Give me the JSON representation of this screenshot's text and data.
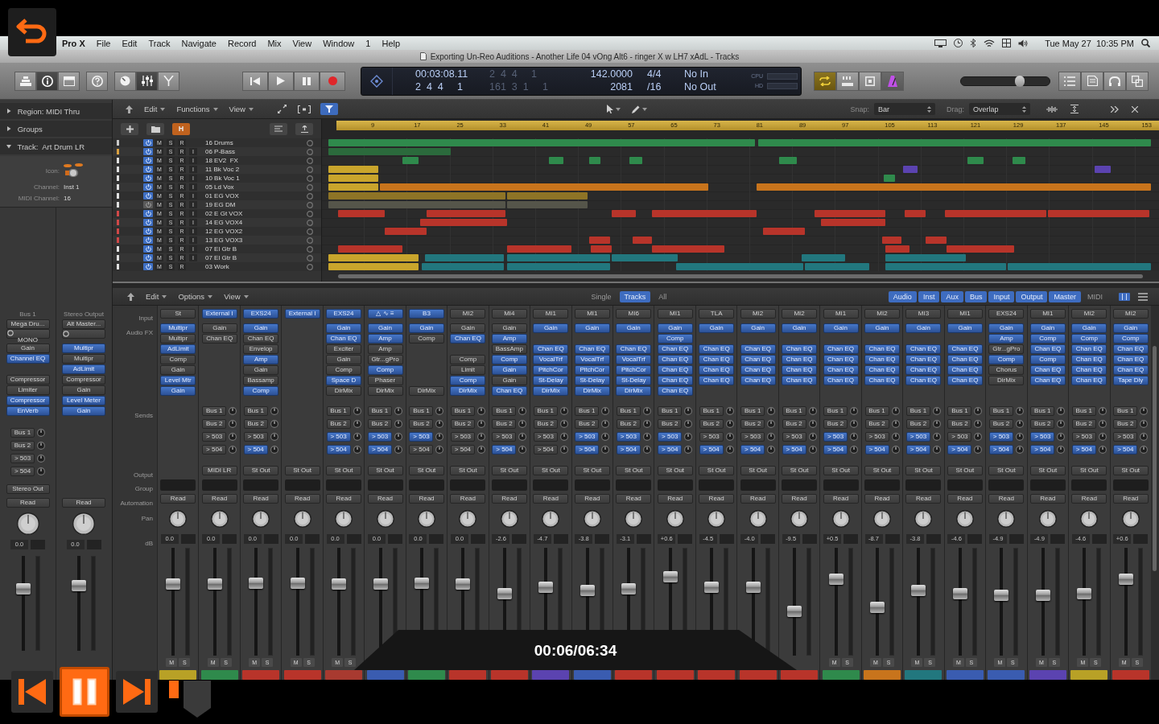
{
  "player": {
    "time": "00:06/06:34"
  },
  "menu_bar": {
    "items": [
      "Pro X",
      "File",
      "Edit",
      "Track",
      "Navigate",
      "Record",
      "Mix",
      "View",
      "Window",
      "1",
      "Help"
    ],
    "clock": "Tue May 27  10:35 PM"
  },
  "window": {
    "title": "Exporting Un-Reo Auditions - Another Life 04 vOng Alt6 - ringer X w LH7 xAdL - Tracks"
  },
  "toolbar": {
    "view_buttons": [
      {
        "selected": false
      },
      {
        "selected": true
      },
      {
        "selected": false
      },
      {
        "selected": false
      },
      {
        "selected": false
      },
      {
        "selected": true
      },
      {
        "selected": false
      }
    ],
    "lcd": {
      "time": "00:03:08.11",
      "bars": "2  4  4     1",
      "time_dim": "2  4  4     1",
      "bars_dim": "161  3  1     1",
      "tempo": "142.0000",
      "tempo_sub": "2081",
      "signature": "4/4",
      "division": "/16",
      "in": "No In",
      "out": "No Out",
      "cpu": "CPU",
      "hd": "HD"
    },
    "mode_buttons": [
      {
        "selected": true
      },
      {
        "selected": false
      },
      {
        "selected": false
      },
      {
        "selected": true
      }
    ],
    "volume": {
      "level": 0.68
    }
  },
  "inspector": {
    "sections": [
      {
        "label": "Region: MIDI Thru",
        "expanded": false
      },
      {
        "label": "Groups",
        "expanded": false
      },
      {
        "label": "Track:  Art Drum LR",
        "expanded": true
      }
    ],
    "params": [
      {
        "kind": "icon",
        "label": "Icon:"
      },
      {
        "kind": "text",
        "label": "Channel:",
        "value": "Inst 1"
      },
      {
        "kind": "text",
        "label": "MIDI Channel:",
        "value": "16"
      }
    ],
    "strips": [
      {
        "header": "Bus 1",
        "input": "Mega Dru...",
        "format": "MONO",
        "fx": [
          {
            "kind": "plugin",
            "name": "Gain",
            "on": false
          },
          {
            "kind": "plugin",
            "name": "Channel EQ",
            "on": true
          },
          {
            "kind": "empty"
          },
          {
            "kind": "plugin",
            "name": "Compressor",
            "on": false
          },
          {
            "kind": "plugin",
            "name": "Limiter",
            "on": false
          },
          {
            "kind": "plugin",
            "name": "Compressor",
            "on": true
          },
          {
            "kind": "plugin",
            "name": "EnVerb",
            "on": true
          }
        ],
        "sends": [
          {
            "name": "Bus 1",
            "on": false
          },
          {
            "name": "Bus 2",
            "on": false
          },
          {
            "name": "> 503",
            "on": false
          },
          {
            "name": "> 504",
            "on": false
          }
        ],
        "output": "Stereo Out",
        "automation": "Read",
        "db": "0.0",
        "level": 0.67
      },
      {
        "header": "Stereo Output",
        "input": "Alt Master...",
        "fx": [
          {
            "kind": "plugin",
            "name": "Multipr",
            "on": true
          },
          {
            "kind": "plugin",
            "name": "Multipr",
            "on": false
          },
          {
            "kind": "plugin",
            "name": "AdLimit",
            "on": true
          },
          {
            "kind": "plugin",
            "name": "Compressor",
            "on": false
          },
          {
            "kind": "plugin",
            "name": "Gain",
            "on": false
          },
          {
            "kind": "plugin",
            "name": "Level Meter",
            "on": true
          },
          {
            "kind": "plugin",
            "name": "Gain",
            "on": true
          }
        ],
        "automation": "Read",
        "db": "0.0",
        "level": 0.71
      }
    ]
  },
  "tracks": {
    "menus": [
      "Edit",
      "Functions",
      "View"
    ],
    "snap_label": "Snap:",
    "snap": "Bar",
    "drag_label": "Drag:",
    "drag": "Overlap",
    "hide_button": {
      "label": "H",
      "on": true
    },
    "ruler": [
      "9",
      "17",
      "25",
      "33",
      "41",
      "49",
      "57",
      "65",
      "73",
      "81",
      "89",
      "97",
      "105",
      "113",
      "121",
      "129",
      "137",
      "145",
      "153"
    ],
    "rows": [
      {
        "name": "16 Drums",
        "color": "#c9c9c9",
        "enabled": true,
        "buttons": [
          "M",
          "S",
          "R"
        ]
      },
      {
        "name": "06 P-Bass",
        "color": "#d9a040",
        "enabled": true,
        "buttons": [
          "M",
          "S",
          "R",
          "I"
        ]
      },
      {
        "name": "18 EV2  FX",
        "color": "#e0e0e0",
        "enabled": true,
        "buttons": [
          "M",
          "S",
          "R",
          "I"
        ]
      },
      {
        "name": "11 Bk Voc 2",
        "color": "#e0e0e0",
        "enabled": true,
        "buttons": [
          "M",
          "S",
          "R",
          "I"
        ]
      },
      {
        "name": "10 Bk Voc 1",
        "color": "#e0e0e0",
        "enabled": true,
        "buttons": [
          "M",
          "S",
          "R",
          "I"
        ]
      },
      {
        "name": "05 Ld Vox",
        "color": "#e0e0e0",
        "enabled": true,
        "buttons": [
          "M",
          "S",
          "R",
          "I"
        ]
      },
      {
        "name": "01 EG VOX",
        "color": "#e0e0e0",
        "enabled": true,
        "buttons": [
          "M",
          "S",
          "R",
          "I"
        ]
      },
      {
        "name": "19 EG DM",
        "color": "#e0e0e0",
        "enabled": false,
        "buttons": [
          "M",
          "S",
          "R",
          "I"
        ]
      },
      {
        "name": "02 E Gt VOX",
        "color": "#d04848",
        "enabled": true,
        "buttons": [
          "M",
          "S",
          "R",
          "I"
        ]
      },
      {
        "name": "14 EG VOX4",
        "color": "#d04848",
        "enabled": true,
        "buttons": [
          "M",
          "S",
          "R",
          "I"
        ]
      },
      {
        "name": "12 EG VOX2",
        "color": "#d04848",
        "enabled": true,
        "buttons": [
          "M",
          "S",
          "R",
          "I"
        ]
      },
      {
        "name": "13 EG VOX3",
        "color": "#d04848",
        "enabled": true,
        "buttons": [
          "M",
          "S",
          "R",
          "I"
        ]
      },
      {
        "name": "07 El Gtr B",
        "color": "#e0e0e0",
        "enabled": true,
        "buttons": [
          "M",
          "S",
          "R",
          "I"
        ]
      },
      {
        "name": "07 El Gtr B",
        "color": "#e0e0e0",
        "enabled": true,
        "buttons": [
          "M",
          "S",
          "R",
          "I"
        ]
      },
      {
        "name": "03 Work",
        "color": "#e0e0e0",
        "enabled": true,
        "buttons": [
          "M",
          "S",
          "R"
        ]
      }
    ]
  },
  "mixer": {
    "menus": [
      "Edit",
      "Options",
      "View"
    ],
    "views": [
      {
        "label": "Single",
        "selected": false
      },
      {
        "label": "Tracks",
        "selected": true
      },
      {
        "label": "All",
        "selected": false
      }
    ],
    "filters": [
      {
        "label": "Audio",
        "selected": true
      },
      {
        "label": "Inst",
        "selected": true
      },
      {
        "label": "Aux",
        "selected": true
      },
      {
        "label": "Bus",
        "selected": true
      },
      {
        "label": "Input",
        "selected": true
      },
      {
        "label": "Output",
        "selected": true
      },
      {
        "label": "Master",
        "selected": true
      },
      {
        "label": "MIDI",
        "selected": false
      }
    ],
    "row_labels": [
      "Input",
      "Audio FX",
      "Sends",
      "Output",
      "Group",
      "Automation",
      "Pan",
      "dB"
    ],
    "strips": [
      {
        "input": "St",
        "input_on": false,
        "fx": [
          {
            "kind": "plugin",
            "name": "Multipr",
            "on": true
          },
          {
            "kind": "plugin",
            "name": "Multipr",
            "on": false
          },
          {
            "kind": "plugin",
            "name": "AdLimit",
            "on": true
          },
          {
            "kind": "plugin",
            "name": "Comp",
            "on": false
          },
          {
            "kind": "plugin",
            "name": "Gain",
            "on": false
          },
          {
            "kind": "plugin",
            "name": "Level Mtr",
            "on": true
          },
          {
            "kind": "plugin",
            "name": "Gain",
            "on": true
          }
        ],
        "automation": "Read",
        "db": "0.0",
        "level": 0.68,
        "buttons": [
          "M",
          "S"
        ],
        "color": "#b8a126"
      },
      {
        "input": "External I",
        "input_on": true,
        "fx": [
          {
            "kind": "plugin",
            "name": "Gain",
            "on": false
          },
          {
            "kind": "plugin",
            "name": "Chan EQ",
            "on": false
          }
        ],
        "sends": [
          {
            "name": "Bus 1",
            "on": false
          },
          {
            "name": "Bus 2",
            "on": false
          },
          {
            "name": "> 503",
            "on": false
          },
          {
            "name": "> 504",
            "on": false
          }
        ],
        "output": "MIDI LR",
        "automation": "Read",
        "db": "0.0",
        "level": 0.68,
        "buttons": [
          "M",
          "S"
        ],
        "color": "#2f8a4c"
      },
      {
        "input": "EXS24",
        "input_on": true,
        "fx": [
          {
            "kind": "plugin",
            "name": "Gain",
            "on": true
          },
          {
            "kind": "plugin",
            "name": "Chan EQ",
            "on": false
          },
          {
            "kind": "plugin",
            "name": "Envelop",
            "on": false
          },
          {
            "kind": "plugin",
            "name": "Amp",
            "on": true
          },
          {
            "kind": "plugin",
            "name": "Gain",
            "on": false
          },
          {
            "kind": "plugin",
            "name": "Bassamp",
            "on": false
          },
          {
            "kind": "plugin",
            "name": "Comp",
            "on": true
          }
        ],
        "sends": [
          {
            "name": "Bus 1",
            "on": false
          },
          {
            "name": "Bus 2",
            "on": false
          },
          {
            "name": "> 503",
            "on": false
          },
          {
            "name": "> 504",
            "on": true
          }
        ],
        "output": "St Out",
        "automation": "Read",
        "db": "0.0",
        "level": 0.69,
        "buttons": [
          "M",
          "S"
        ],
        "color": "#b8342a"
      },
      {
        "input": "External I",
        "input_on": true,
        "output": "St Out",
        "automation": "Read",
        "db": "0.0",
        "level": 0.69,
        "buttons": [
          "M",
          "S"
        ],
        "color": "#b8342a"
      },
      {
        "input": "EXS24",
        "input_on": true,
        "fx": [
          {
            "kind": "plugin",
            "name": "Gain",
            "on": true
          },
          {
            "kind": "plugin",
            "name": "Chan EQ",
            "on": true
          },
          {
            "kind": "plugin",
            "name": "Exciter",
            "on": false
          },
          {
            "kind": "plugin",
            "name": "Gain",
            "on": false
          },
          {
            "kind": "plugin",
            "name": "Comp",
            "on": false
          },
          {
            "kind": "plugin",
            "name": "Space D",
            "on": true
          },
          {
            "kind": "plugin",
            "name": "DirMix",
            "on": false
          }
        ],
        "sends": [
          {
            "name": "Bus 1",
            "on": false
          },
          {
            "name": "Bus 2",
            "on": false
          },
          {
            "name": "> 503",
            "on": true
          },
          {
            "name": "> 504",
            "on": true
          }
        ],
        "output": "St Out",
        "automation": "Read",
        "db": "0.0",
        "level": 0.68,
        "buttons": [
          "M",
          "S"
        ],
        "color": "#a83a30"
      },
      {
        "input": "△ ∿ ≡",
        "input_on": true,
        "fx": [
          {
            "kind": "plugin",
            "name": "Gain",
            "on": true
          },
          {
            "kind": "plugin",
            "name": "Amp",
            "on": true
          },
          {
            "kind": "plugin",
            "name": "Amp",
            "on": false
          },
          {
            "kind": "plugin",
            "name": "Gtr...gPro",
            "on": false
          },
          {
            "kind": "plugin",
            "name": "Comp",
            "on": true
          },
          {
            "kind": "plugin",
            "name": "Phaser",
            "on": false
          },
          {
            "kind": "plugin",
            "name": "DirMix",
            "on": false
          }
        ],
        "sends": [
          {
            "name": "Bus 1",
            "on": false
          },
          {
            "name": "Bus 2",
            "on": false
          },
          {
            "name": "> 503",
            "on": true
          },
          {
            "name": "> 504",
            "on": true
          }
        ],
        "output": "St Out",
        "automation": "Read",
        "db": "0.0",
        "level": 0.68,
        "color": "#3a5cb0"
      },
      {
        "input": "B3",
        "input_on": true,
        "fx": [
          {
            "kind": "plugin",
            "name": "Gain",
            "on": true
          },
          {
            "kind": "plugin",
            "name": "Comp",
            "on": false
          },
          {
            "kind": "empty"
          },
          {
            "kind": "empty"
          },
          {
            "kind": "empty"
          },
          {
            "kind": "empty"
          },
          {
            "kind": "plugin",
            "name": "DirMix",
            "on": false
          }
        ],
        "sends": [
          {
            "name": "Bus 1",
            "on": false
          },
          {
            "name": "Bus 2",
            "on": false
          },
          {
            "name": "> 503",
            "on": true
          },
          {
            "name": "> 504",
            "on": false
          }
        ],
        "output": "St Out",
        "automation": "Read",
        "db": "0.0",
        "level": 0.69,
        "color": "#2f8a4c"
      },
      {
        "input": "MI2",
        "input_on": false,
        "fx": [
          {
            "kind": "plugin",
            "name": "Gain",
            "on": false
          },
          {
            "kind": "plugin",
            "name": "Chan EQ",
            "on": true
          },
          {
            "kind": "empty"
          },
          {
            "kind": "plugin",
            "name": "Comp",
            "on": false
          },
          {
            "kind": "plugin",
            "name": "Limit",
            "on": false
          },
          {
            "kind": "plugin",
            "name": "Comp",
            "on": true
          },
          {
            "kind": "plugin",
            "name": "DirMix",
            "on": true
          }
        ],
        "sends": [
          {
            "name": "Bus 1",
            "on": false
          },
          {
            "name": "Bus 2",
            "on": false
          },
          {
            "name": "> 503",
            "on": false
          },
          {
            "name": "> 504",
            "on": false
          }
        ],
        "output": "St Out",
        "automation": "Read",
        "db": "0.0",
        "level": 0.68,
        "color": "#b8342a"
      },
      {
        "input": "MI4",
        "input_on": false,
        "fx": [
          {
            "kind": "plugin",
            "name": "Gain",
            "on": false
          },
          {
            "kind": "plugin",
            "name": "Amp",
            "on": true
          },
          {
            "kind": "plugin",
            "name": "BassAmp",
            "on": false
          },
          {
            "kind": "plugin",
            "name": "Comp",
            "on": true
          },
          {
            "kind": "plugin",
            "name": "Gain",
            "on": true
          },
          {
            "kind": "plugin",
            "name": "Gain",
            "on": false
          },
          {
            "kind": "plugin",
            "name": "Chan EQ",
            "on": true
          }
        ],
        "sends": [
          {
            "name": "Bus 1",
            "on": false
          },
          {
            "name": "Bus 2",
            "on": false
          },
          {
            "name": "> 503",
            "on": false
          },
          {
            "name": "> 504",
            "on": true
          }
        ],
        "output": "St Out",
        "automation": "Read",
        "db": "-2.6",
        "level": 0.58,
        "color": "#b8342a"
      },
      {
        "input": "MI1",
        "input_on": false,
        "fx": [
          {
            "kind": "plugin",
            "name": "Gain",
            "on": true
          },
          {
            "kind": "empty"
          },
          {
            "kind": "plugin",
            "name": "Chan EQ",
            "on": true
          },
          {
            "kind": "plugin",
            "name": "VocalTrf",
            "on": true
          },
          {
            "kind": "plugin",
            "name": "PitchCor",
            "on": true
          },
          {
            "kind": "plugin",
            "name": "St-Delay",
            "on": true
          },
          {
            "kind": "plugin",
            "name": "DirMix",
            "on": true
          }
        ],
        "sends": [
          {
            "name": "Bus 1",
            "on": false
          },
          {
            "name": "Bus 2",
            "on": false
          },
          {
            "name": "> 503",
            "on": false
          },
          {
            "name": "> 504",
            "on": false
          }
        ],
        "output": "St Out",
        "automation": "Read",
        "db": "-4.7",
        "level": 0.65,
        "color": "#5b43b0"
      },
      {
        "input": "MI1",
        "input_on": false,
        "fx": [
          {
            "kind": "plugin",
            "name": "Gain",
            "on": true
          },
          {
            "kind": "empty"
          },
          {
            "kind": "plugin",
            "name": "Chan EQ",
            "on": true
          },
          {
            "kind": "plugin",
            "name": "VocalTrf",
            "on": true
          },
          {
            "kind": "plugin",
            "name": "PitchCor",
            "on": true
          },
          {
            "kind": "plugin",
            "name": "St-Delay",
            "on": true
          },
          {
            "kind": "plugin",
            "name": "DirMix",
            "on": true
          }
        ],
        "sends": [
          {
            "name": "Bus 1",
            "on": false
          },
          {
            "name": "Bus 2",
            "on": false
          },
          {
            "name": "> 503",
            "on": true
          },
          {
            "name": "> 504",
            "on": true
          }
        ],
        "output": "St Out",
        "automation": "Read",
        "db": "-3.8",
        "level": 0.62,
        "color": "#3a5cb0"
      },
      {
        "input": "MI6",
        "input_on": false,
        "fx": [
          {
            "kind": "plugin",
            "name": "Gain",
            "on": true
          },
          {
            "kind": "empty"
          },
          {
            "kind": "plugin",
            "name": "Chan EQ",
            "on": true
          },
          {
            "kind": "plugin",
            "name": "VocalTrf",
            "on": true
          },
          {
            "kind": "plugin",
            "name": "PitchCor",
            "on": true
          },
          {
            "kind": "plugin",
            "name": "St-Delay",
            "on": true
          },
          {
            "kind": "plugin",
            "name": "DirMix",
            "on": true
          }
        ],
        "sends": [
          {
            "name": "Bus 1",
            "on": false
          },
          {
            "name": "Bus 2",
            "on": false
          },
          {
            "name": "> 503",
            "on": true
          },
          {
            "name": "> 504",
            "on": true
          }
        ],
        "output": "St Out",
        "automation": "Read",
        "db": "-3.1",
        "level": 0.63,
        "color": "#b8342a"
      },
      {
        "input": "MI1",
        "input_on": false,
        "fx": [
          {
            "kind": "plugin",
            "name": "Gain",
            "on": true
          },
          {
            "kind": "plugin",
            "name": "Comp",
            "on": true
          },
          {
            "kind": "plugin",
            "name": "Chan EQ",
            "on": true
          },
          {
            "kind": "plugin",
            "name": "Chan EQ",
            "on": true
          },
          {
            "kind": "plugin",
            "name": "Chan EQ",
            "on": true
          },
          {
            "kind": "plugin",
            "name": "Chan EQ",
            "on": true
          },
          {
            "kind": "plugin",
            "name": "Chan EQ",
            "on": true
          }
        ],
        "sends": [
          {
            "name": "Bus 1",
            "on": false
          },
          {
            "name": "Bus 2",
            "on": false
          },
          {
            "name": "> 503",
            "on": true
          },
          {
            "name": "> 504",
            "on": true
          }
        ],
        "output": "St Out",
        "automation": "Read",
        "db": "+0.6",
        "level": 0.76,
        "color": "#b8342a"
      },
      {
        "input": "TLA",
        "input_on": false,
        "fx": [
          {
            "kind": "plugin",
            "name": "Gain",
            "on": true
          },
          {
            "kind": "empty"
          },
          {
            "kind": "plugin",
            "name": "Chan EQ",
            "on": true
          },
          {
            "kind": "plugin",
            "name": "Chan EQ",
            "on": true
          },
          {
            "kind": "plugin",
            "name": "Chan EQ",
            "on": true
          },
          {
            "kind": "plugin",
            "name": "Chan EQ",
            "on": true
          }
        ],
        "sends": [
          {
            "name": "Bus 1",
            "on": false
          },
          {
            "name": "Bus 2",
            "on": false
          },
          {
            "name": "> 503",
            "on": false
          },
          {
            "name": "> 504",
            "on": true
          }
        ],
        "output": "St Out",
        "automation": "Read",
        "db": "-4.5",
        "level": 0.65,
        "color": "#b8342a"
      },
      {
        "input": "MI2",
        "input_on": false,
        "fx": [
          {
            "kind": "plugin",
            "name": "Gain",
            "on": true
          },
          {
            "kind": "empty"
          },
          {
            "kind": "plugin",
            "name": "Chan EQ",
            "on": true
          },
          {
            "kind": "plugin",
            "name": "Chan EQ",
            "on": true
          },
          {
            "kind": "plugin",
            "name": "Chan EQ",
            "on": true
          },
          {
            "kind": "plugin",
            "name": "Chan EQ",
            "on": true
          }
        ],
        "sends": [
          {
            "name": "Bus 1",
            "on": false
          },
          {
            "name": "Bus 2",
            "on": false
          },
          {
            "name": "> 503",
            "on": false
          },
          {
            "name": "> 504",
            "on": true
          }
        ],
        "output": "St Out",
        "automation": "Read",
        "db": "-4.0",
        "level": 0.65,
        "color": "#b8342a"
      },
      {
        "input": "MI2",
        "input_on": false,
        "fx": [
          {
            "kind": "plugin",
            "name": "Gain",
            "on": true
          },
          {
            "kind": "empty"
          },
          {
            "kind": "plugin",
            "name": "Chan EQ",
            "on": true
          },
          {
            "kind": "plugin",
            "name": "Chan EQ",
            "on": true
          },
          {
            "kind": "plugin",
            "name": "Chan EQ",
            "on": true
          },
          {
            "kind": "plugin",
            "name": "Chan EQ",
            "on": true
          }
        ],
        "sends": [
          {
            "name": "Bus 1",
            "on": false
          },
          {
            "name": "Bus 2",
            "on": false
          },
          {
            "name": "> 503",
            "on": false
          },
          {
            "name": "> 504",
            "on": true
          }
        ],
        "output": "St Out",
        "automation": "Read",
        "db": "-9.5",
        "level": 0.4,
        "color": "#b8342a"
      },
      {
        "input": "MI1",
        "input_on": false,
        "fx": [
          {
            "kind": "plugin",
            "name": "Gain",
            "on": true
          },
          {
            "kind": "empty"
          },
          {
            "kind": "plugin",
            "name": "Chan EQ",
            "on": true
          },
          {
            "kind": "plugin",
            "name": "Chan EQ",
            "on": true
          },
          {
            "kind": "plugin",
            "name": "Chan EQ",
            "on": true
          },
          {
            "kind": "plugin",
            "name": "Chan EQ",
            "on": true
          }
        ],
        "sends": [
          {
            "name": "Bus 1",
            "on": false
          },
          {
            "name": "Bus 2",
            "on": false
          },
          {
            "name": "> 503",
            "on": true
          },
          {
            "name": "> 504",
            "on": true
          }
        ],
        "output": "St Out",
        "automation": "Read",
        "db": "+0.5",
        "level": 0.73,
        "buttons": [
          "M",
          "S"
        ],
        "color": "#2f8a4c"
      },
      {
        "input": "MI2",
        "input_on": false,
        "fx": [
          {
            "kind": "plugin",
            "name": "Gain",
            "on": true
          },
          {
            "kind": "empty"
          },
          {
            "kind": "plugin",
            "name": "Chan EQ",
            "on": true
          },
          {
            "kind": "plugin",
            "name": "Chan EQ",
            "on": true
          },
          {
            "kind": "plugin",
            "name": "Chan EQ",
            "on": true
          },
          {
            "kind": "plugin",
            "name": "Chan EQ",
            "on": true
          }
        ],
        "sends": [
          {
            "name": "Bus 1",
            "on": false
          },
          {
            "name": "Bus 2",
            "on": false
          },
          {
            "name": "> 503",
            "on": false
          },
          {
            "name": "> 504",
            "on": true
          }
        ],
        "output": "St Out",
        "automation": "Read",
        "db": "-8.7",
        "level": 0.44,
        "buttons": [
          "M",
          "S"
        ],
        "color": "#c8741c"
      },
      {
        "input": "MI3",
        "input_on": false,
        "fx": [
          {
            "kind": "plugin",
            "name": "Gain",
            "on": true
          },
          {
            "kind": "empty"
          },
          {
            "kind": "plugin",
            "name": "Chan EQ",
            "on": true
          },
          {
            "kind": "plugin",
            "name": "Chan EQ",
            "on": true
          },
          {
            "kind": "plugin",
            "name": "Chan EQ",
            "on": true
          },
          {
            "kind": "plugin",
            "name": "Chan EQ",
            "on": true
          }
        ],
        "sends": [
          {
            "name": "Bus 1",
            "on": false
          },
          {
            "name": "Bus 2",
            "on": false
          },
          {
            "name": "> 503",
            "on": true
          },
          {
            "name": "> 504",
            "on": true
          }
        ],
        "output": "St Out",
        "automation": "Read",
        "db": "-3.8",
        "level": 0.62,
        "buttons": [
          "M",
          "S"
        ],
        "color": "#22777e"
      },
      {
        "input": "MI1",
        "input_on": false,
        "fx": [
          {
            "kind": "plugin",
            "name": "Gain",
            "on": true
          },
          {
            "kind": "empty"
          },
          {
            "kind": "plugin",
            "name": "Chan EQ",
            "on": true
          },
          {
            "kind": "plugin",
            "name": "Chan EQ",
            "on": true
          },
          {
            "kind": "plugin",
            "name": "Chan EQ",
            "on": true
          },
          {
            "kind": "plugin",
            "name": "Chan EQ",
            "on": true
          }
        ],
        "sends": [
          {
            "name": "Bus 1",
            "on": false
          },
          {
            "name": "Bus 2",
            "on": false
          },
          {
            "name": "> 503",
            "on": false
          },
          {
            "name": "> 504",
            "on": true
          }
        ],
        "output": "St Out",
        "automation": "Read",
        "db": "-4.6",
        "level": 0.58,
        "buttons": [
          "M",
          "S"
        ],
        "color": "#3a5cb0"
      },
      {
        "input": "EXS24",
        "input_on": false,
        "fx": [
          {
            "kind": "plugin",
            "name": "Gain",
            "on": true
          },
          {
            "kind": "plugin",
            "name": "Amp",
            "on": true
          },
          {
            "kind": "plugin",
            "name": "Gtr...gPro",
            "on": false
          },
          {
            "kind": "plugin",
            "name": "Comp",
            "on": true
          },
          {
            "kind": "plugin",
            "name": "Chorus",
            "on": false
          },
          {
            "kind": "plugin",
            "name": "DirMix",
            "on": false
          }
        ],
        "sends": [
          {
            "name": "Bus 1",
            "on": false
          },
          {
            "name": "Bus 2",
            "on": false
          },
          {
            "name": "> 503",
            "on": true
          },
          {
            "name": "> 504",
            "on": true
          }
        ],
        "output": "St Out",
        "automation": "Read",
        "db": "-4.9",
        "level": 0.57,
        "buttons": [
          "M",
          "S"
        ],
        "color": "#3a5cb0"
      },
      {
        "input": "MI1",
        "input_on": false,
        "fx": [
          {
            "kind": "plugin",
            "name": "Gain",
            "on": true
          },
          {
            "kind": "plugin",
            "name": "Comp",
            "on": true
          },
          {
            "kind": "plugin",
            "name": "Chan EQ",
            "on": true
          },
          {
            "kind": "plugin",
            "name": "Comp",
            "on": true
          },
          {
            "kind": "plugin",
            "name": "Chan EQ",
            "on": true
          },
          {
            "kind": "plugin",
            "name": "Chan EQ",
            "on": true
          }
        ],
        "sends": [
          {
            "name": "Bus 1",
            "on": false
          },
          {
            "name": "Bus 2",
            "on": false
          },
          {
            "name": "> 503",
            "on": true
          },
          {
            "name": "> 504",
            "on": true
          }
        ],
        "output": "St Out",
        "automation": "Read",
        "db": "-4.9",
        "level": 0.57,
        "buttons": [
          "M",
          "S"
        ],
        "color": "#5b43b0"
      },
      {
        "input": "MI2",
        "input_on": false,
        "fx": [
          {
            "kind": "plugin",
            "name": "Gain",
            "on": true
          },
          {
            "kind": "plugin",
            "name": "Comp",
            "on": true
          },
          {
            "kind": "plugin",
            "name": "Chan EQ",
            "on": true
          },
          {
            "kind": "plugin",
            "name": "Chan EQ",
            "on": true
          },
          {
            "kind": "plugin",
            "name": "Chan EQ",
            "on": true
          },
          {
            "kind": "plugin",
            "name": "Chan EQ",
            "on": true
          }
        ],
        "sends": [
          {
            "name": "Bus 1",
            "on": false
          },
          {
            "name": "Bus 2",
            "on": false
          },
          {
            "name": "> 503",
            "on": false
          },
          {
            "name": "> 504",
            "on": true
          }
        ],
        "output": "St Out",
        "automation": "Read",
        "db": "-4.6",
        "level": 0.58,
        "buttons": [
          "M",
          "S"
        ],
        "color": "#b8a126"
      },
      {
        "input": "MI2",
        "input_on": false,
        "fx": [
          {
            "kind": "plugin",
            "name": "Gain",
            "on": true
          },
          {
            "kind": "plugin",
            "name": "Comp",
            "on": true
          },
          {
            "kind": "plugin",
            "name": "Chan EQ",
            "on": true
          },
          {
            "kind": "plugin",
            "name": "Chan EQ",
            "on": true
          },
          {
            "kind": "plugin",
            "name": "Chan EQ",
            "on": true
          },
          {
            "kind": "plugin",
            "name": "Tape Dly",
            "on": true
          }
        ],
        "sends": [
          {
            "name": "Bus 1",
            "on": false
          },
          {
            "name": "Bus 2",
            "on": false
          },
          {
            "name": "> 503",
            "on": false
          },
          {
            "name": "> 504",
            "on": true
          }
        ],
        "output": "St Out",
        "automation": "Read",
        "db": "+0.6",
        "level": 0.73,
        "buttons": [
          "M",
          "S"
        ],
        "color": "#b8342a"
      }
    ]
  }
}
